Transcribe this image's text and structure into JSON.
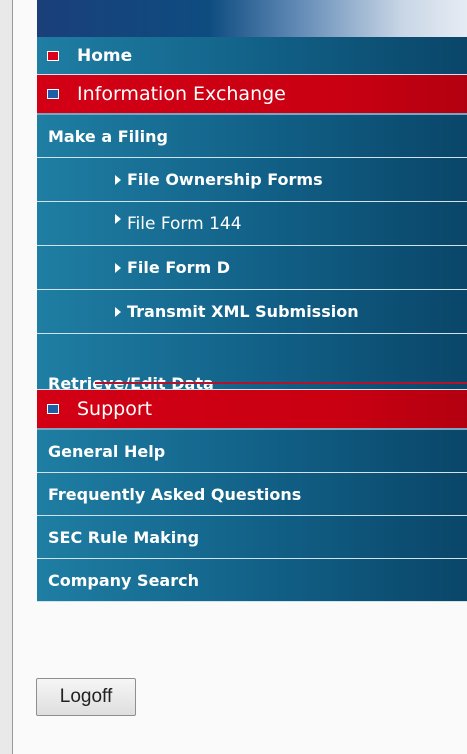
{
  "nav": {
    "home": {
      "label": "Home",
      "bullet": "red"
    },
    "info_exchange": {
      "label": "Information Exchange",
      "bullet": "blue"
    },
    "make_filing": {
      "label": "Make a Filing"
    },
    "sub_items": [
      {
        "label": "File Ownership Forms"
      },
      {
        "label": "File Form 144"
      },
      {
        "label": "File Form D"
      },
      {
        "label": "Transmit XML Submission"
      }
    ],
    "retrieve_edit": {
      "label": "Retrieve/Edit Data"
    },
    "support": {
      "label": "Support",
      "bullet": "blue"
    },
    "support_items": [
      {
        "label": "General Help"
      },
      {
        "label": "Frequently Asked Questions"
      },
      {
        "label": "SEC Rule Making"
      },
      {
        "label": "Company Search"
      }
    ]
  },
  "buttons": {
    "logoff": "Logoff"
  },
  "colors": {
    "section_red": "#d30015",
    "nav_blue": "#115f86",
    "bullet_red": "#d8001a",
    "bullet_blue": "#1c5fa8"
  }
}
